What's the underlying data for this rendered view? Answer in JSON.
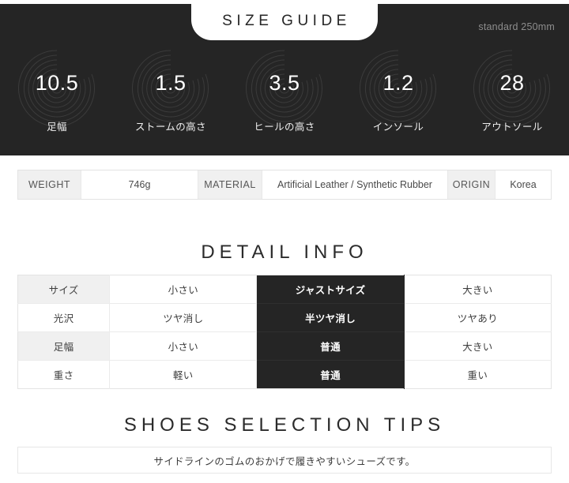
{
  "colors": {
    "dark_panel": "#252525",
    "page_bg": "#ffffff",
    "header_cell_bg": "#f0f0f0",
    "border": "#e3e3e3",
    "selected_cell_bg": "#252525",
    "muted_text": "#8d8d8d"
  },
  "size_guide": {
    "tab_label": "SIZE GUIDE",
    "standard_note": "standard 250mm",
    "metrics": [
      {
        "value": "10.5",
        "label": "足幅",
        "ring_icon": "tree-ring-icon"
      },
      {
        "value": "1.5",
        "label": "ストームの高さ",
        "ring_icon": "tree-ring-icon"
      },
      {
        "value": "3.5",
        "label": "ヒールの高さ",
        "ring_icon": "tree-ring-icon"
      },
      {
        "value": "1.2",
        "label": "インソール",
        "ring_icon": "tree-ring-icon"
      },
      {
        "value": "28",
        "label": "アウトソール",
        "ring_icon": "tree-ring-icon"
      }
    ]
  },
  "spec_table": {
    "weight_label": "WEIGHT",
    "weight_value": "746g",
    "material_label": "MATERIAL",
    "material_value": "Artificial Leather / Synthetic Rubber",
    "origin_label": "ORIGIN",
    "origin_value": "Korea"
  },
  "detail_info": {
    "title": "DETAIL INFO",
    "rows": [
      {
        "label": "サイズ",
        "options": [
          "小さい",
          "ジャストサイズ",
          "大きい"
        ],
        "selected_index": 1
      },
      {
        "label": "光沢",
        "options": [
          "ツヤ消し",
          "半ツヤ消し",
          "ツヤあり"
        ],
        "selected_index": 1
      },
      {
        "label": "足幅",
        "options": [
          "小さい",
          "普通",
          "大きい"
        ],
        "selected_index": 1
      },
      {
        "label": "重さ",
        "options": [
          "軽い",
          "普通",
          "重い"
        ],
        "selected_index": 1
      }
    ]
  },
  "tips": {
    "title": "SHOES SELECTION TIPS",
    "text": "サイドラインのゴムのおかげで履きやすいシューズです。"
  }
}
